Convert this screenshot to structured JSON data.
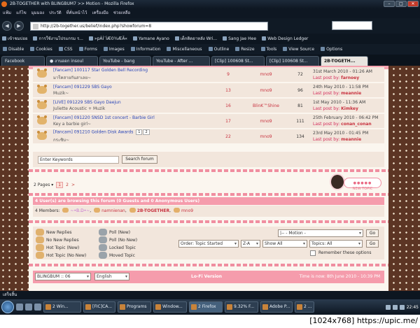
{
  "window": {
    "title": "2B-TOGETHER with BLINGBUM7 >> Motion - Mozilla Firefox",
    "controls": [
      "–",
      "□",
      "✕"
    ]
  },
  "menu": [
    "แฟ้ม",
    "แก้ไข",
    "มุมมอง",
    "ประวัติ",
    "ที่คั่นหน้าไว้",
    "เครื่องมือ",
    "ช่วยเหลือ"
  ],
  "nav": {
    "back": "◀",
    "forward": "▶",
    "url": "http://2b-together.us/belief/index.php?showforum=8"
  },
  "bookmarks": [
    "เข้าชมบ่อย",
    "การใช้งานโปรแกรม ร...",
    "»pÀÍ¨ÌÆ0¾ÆÃ«",
    "Yamane Ayano",
    "เด็กติดอาหลัง Wri...",
    "Sang Jae Hee",
    "Web Design Ledger"
  ],
  "devtoolbar": [
    "Disable",
    "Cookies",
    "CSS",
    "Forms",
    "Images",
    "Information",
    "Miscellaneous",
    "Outline",
    "Resize",
    "Tools",
    "View Source",
    "Options"
  ],
  "tabs": [
    {
      "label": "Facebook",
      "active": false
    },
    {
      "label": "● งานออก insoul",
      "active": false
    },
    {
      "label": "YouTube - bang",
      "active": false
    },
    {
      "label": "YouTube - After ...",
      "active": false
    },
    {
      "label": "[Clip] 100608 St...",
      "active": false
    },
    {
      "label": "[Clip] 100608 St...",
      "active": false
    },
    {
      "label": "2B-TOGETH...",
      "active": true
    }
  ],
  "topics": [
    {
      "title": "[Fancam] 100117 Star Golden Bell Recording",
      "desc": "มาร็คสายกันสาเลย~",
      "replies": "9",
      "author": "mno9",
      "views": "72",
      "last_date": "31st March 2010 - 01:26 AM",
      "last_user": "farnoey"
    },
    {
      "title": "[Fancam] 091229 SBS Gayo",
      "desc": "Muzik~",
      "replies": "13",
      "author": "mno9",
      "views": "96",
      "last_date": "24th May 2010 - 11:58 PM",
      "last_user": "meannie"
    },
    {
      "title": "[LIVE] 091229 SBS Gayo Daejun",
      "desc": "Juliette Acoustic + Muzik",
      "replies": "16",
      "author": "BlinK™Shine",
      "views": "81",
      "last_date": "1st May 2010 - 11:36 AM",
      "last_user": "Kimkey"
    },
    {
      "title": "[Fancam] 091220 SNSD 1st concert - Barbie Girl",
      "desc": "Key a barbie girl~",
      "replies": "17",
      "author": "mno9",
      "views": "111",
      "last_date": "25th February 2010 - 06:42 PM",
      "last_user": "conan_conan"
    },
    {
      "title": "[Fancam] 091210 Golden Disk Awards",
      "desc": "กระซิบ~",
      "replies": "22",
      "author": "mno9",
      "views": "134",
      "last_date": "23rd May 2010 - 01:45 PM",
      "last_user": "meannie",
      "pages": [
        "1",
        "2"
      ]
    }
  ],
  "last_by_label": "Last post by:",
  "search": {
    "placeholder": "Enter Keywords",
    "button": "Search forum"
  },
  "pagination": {
    "label": "2 Pages ▾",
    "current": "1",
    "next": "2",
    "arrow": ">"
  },
  "new_topic": {
    "dots": "●●●●●",
    "label": "NEW TOPIC"
  },
  "online": {
    "heading": "4 User(s) are browsing this forum (0 Guests and 0 Anonymous Users)",
    "label": "4 Members:",
    "members": [
      "~•B.D•~",
      "namnienan",
      "2B-TOGETHER",
      "mno9"
    ]
  },
  "legend": [
    "New Replies",
    "No New Replies",
    "Hot Topic (New)",
    "Hot Topic (No New)",
    "Poll (New)",
    "Poll (No New)",
    "Locked Topic",
    "Moved Topic"
  ],
  "controls": {
    "jump": "|-- - Motion -",
    "go": "Go",
    "order": "Order: Topic Started",
    "dir": "Z-A",
    "range": "Show All",
    "filter": "Topics: All",
    "remember": "Remember these options"
  },
  "footer": {
    "skin": "BLINGBUM :: 06",
    "lang": "English",
    "lofi": "Lo-Fi Version",
    "time": "Time is now: 8th June 2010 - 10:39 PM"
  },
  "status": "เสร็จสิ้น",
  "taskbar": {
    "items": [
      "2 Win...",
      "[FIC]CA...",
      "Programs",
      "Window...",
      "2 Firefox",
      "9.32% F...",
      "Adobe P...",
      "2 ..."
    ],
    "clock": "22:45"
  },
  "watermark": "[1024x768] https://upic.me/"
}
